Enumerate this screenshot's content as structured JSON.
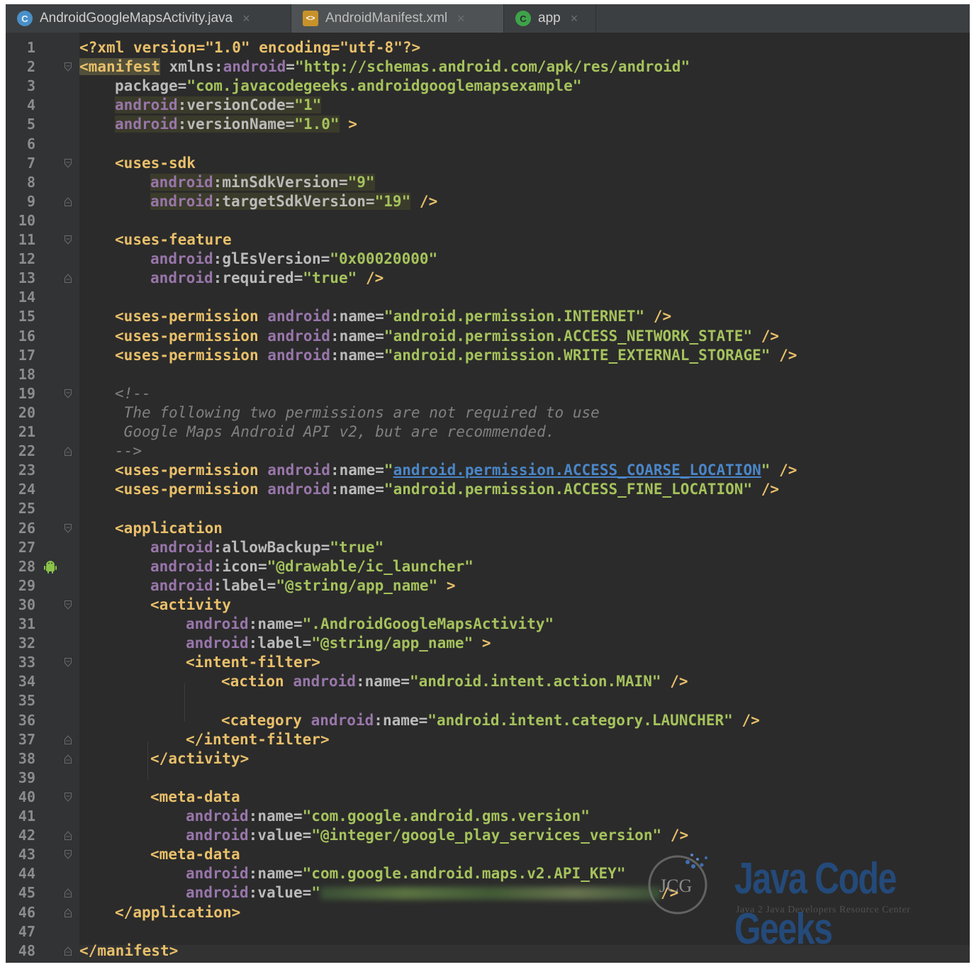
{
  "tabs": [
    {
      "label": "AndroidGoogleMapsActivity.java",
      "icon": "java-class-icon",
      "close": "×"
    },
    {
      "label": "AndroidManifest.xml",
      "icon": "xml-file-icon",
      "close": "×"
    },
    {
      "label": "app",
      "icon": "gradle-app-icon",
      "close": "×"
    }
  ],
  "line_numbers": [
    "1",
    "2",
    "3",
    "4",
    "5",
    "6",
    "7",
    "8",
    "9",
    "10",
    "11",
    "12",
    "13",
    "14",
    "15",
    "16",
    "17",
    "18",
    "19",
    "20",
    "21",
    "22",
    "23",
    "24",
    "25",
    "26",
    "27",
    "28",
    "29",
    "30",
    "31",
    "32",
    "33",
    "34",
    "35",
    "36",
    "37",
    "38",
    "39",
    "40",
    "41",
    "42",
    "43",
    "44",
    "45",
    "46",
    "47",
    "48"
  ],
  "code": {
    "l1_a": "<?xml version=\"1.0\" encoding=\"utf-8\"?>",
    "l2_open": "<manifest",
    "l2_xmlns": " xmlns:",
    "l2_android": "android",
    "l2_eq": "=",
    "l2_val": "\"http://schemas.android.com/apk/res/android\"",
    "l3_attr": "package=",
    "l3_val": "\"com.javacodegeeks.androidgooglemapsexample\"",
    "l4_ns": "android",
    "l4_attr": ":versionCode=",
    "l4_val": "\"1\"",
    "l5_ns": "android",
    "l5_attr": ":versionName=",
    "l5_val": "\"1.0\"",
    "l5_end": " >",
    "l7": "<uses-sdk",
    "l8_ns": "android",
    "l8_attr": ":minSdkVersion=",
    "l8_val": "\"9\"",
    "l9_ns": "android",
    "l9_attr": ":targetSdkVersion=",
    "l9_val": "\"19\"",
    "l9_end": " />",
    "l11": "<uses-feature",
    "l12_ns": "android",
    "l12_attr": ":glEsVersion=",
    "l12_val": "\"0x00020000\"",
    "l13_ns": "android",
    "l13_attr": ":required=",
    "l13_val": "\"true\"",
    "l13_end": " />",
    "up_tag": "<uses-permission",
    "ns": "android",
    "name_attr": ":name=",
    "l15_val": "\"android.permission.INTERNET\"",
    "l16_val": "\"android.permission.ACCESS_NETWORK_STATE\"",
    "l17_val": "\"android.permission.WRITE_EXTERNAL_STORAGE\"",
    "selfclose": " />",
    "l19": "<!--",
    "l20": " The following two permissions are not required to use",
    "l21": " Google Maps Android API v2, but are recommended.",
    "l22": "-->",
    "l23_q1": "\"",
    "l23_link": "android.permission.ACCESS_COARSE_LOCATION",
    "l23_q2": "\"",
    "l24_val": "\"android.permission.ACCESS_FINE_LOCATION\"",
    "l26": "<application",
    "l27_attr": ":allowBackup=",
    "l27_val": "\"true\"",
    "l28_attr": ":icon=",
    "l28_val": "\"@drawable/ic_launcher\"",
    "l29_attr": ":label=",
    "l29_val": "\"@string/app_name\"",
    "gt": " >",
    "l30": "<activity",
    "l31_val": "\".AndroidGoogleMapsActivity\"",
    "l32_attr": ":label=",
    "l32_val": "\"@string/app_name\"",
    "l33": "<intent-filter>",
    "l34_tag": "<action",
    "l34_val": "\"android.intent.action.MAIN\"",
    "l36_tag": "<category",
    "l36_val": "\"android.intent.category.LAUNCHER\"",
    "l37": "</intent-filter>",
    "l38": "</activity>",
    "l40": "<meta-data",
    "l41_val": "\"com.google.android.gms.version\"",
    "l42_attr": ":value=",
    "l42_val": "\"@integer/google_play_services_version\"",
    "l43": "<meta-data",
    "l44_val": "\"com.google.android.maps.v2.API_KEY\"",
    "l45_attr": ":value=",
    "l45_q": "\"",
    "l45_end": "/>",
    "l46": "</application>",
    "l48": "</manifest>"
  },
  "watermark": {
    "title": "Java Code Geeks",
    "subtitle": "Java 2 Java Developers Resource Center",
    "logo_text": "JCG"
  },
  "colors": {
    "background": "#2b2b2b",
    "gutter": "#313335",
    "tag": "#e8bf6a",
    "namespace": "#9876aa",
    "value": "#a5c25c",
    "comment": "#808080",
    "link": "#4a86c8"
  }
}
